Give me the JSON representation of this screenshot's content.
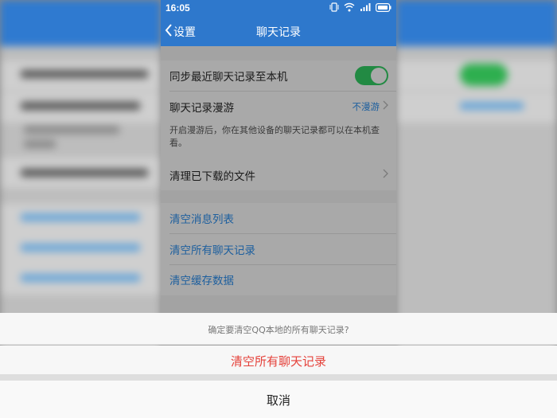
{
  "status": {
    "time": "16:05"
  },
  "nav": {
    "back_label": "设置",
    "title": "聊天记录"
  },
  "settings": {
    "sync_label": "同步最近聊天记录至本机",
    "sync_enabled": true,
    "roaming_label": "聊天记录漫游",
    "roaming_value": "不漫游",
    "roaming_hint": "开启漫游后，你在其他设备的聊天记录都可以在本机查看。",
    "clear_downloads_label": "清理已下载的文件",
    "clear_message_list_label": "清空消息列表",
    "clear_all_history_label": "清空所有聊天记录",
    "clear_cache_label": "清空缓存数据"
  },
  "action_sheet": {
    "message": "确定要清空QQ本地的所有聊天记录?",
    "confirm_label": "清空所有聊天记录",
    "cancel_label": "取消"
  },
  "colors": {
    "header_blue": "#2e78cc",
    "toggle_green": "#228a43",
    "danger_red": "#e5423b",
    "link_blue": "#1d5f9e"
  }
}
